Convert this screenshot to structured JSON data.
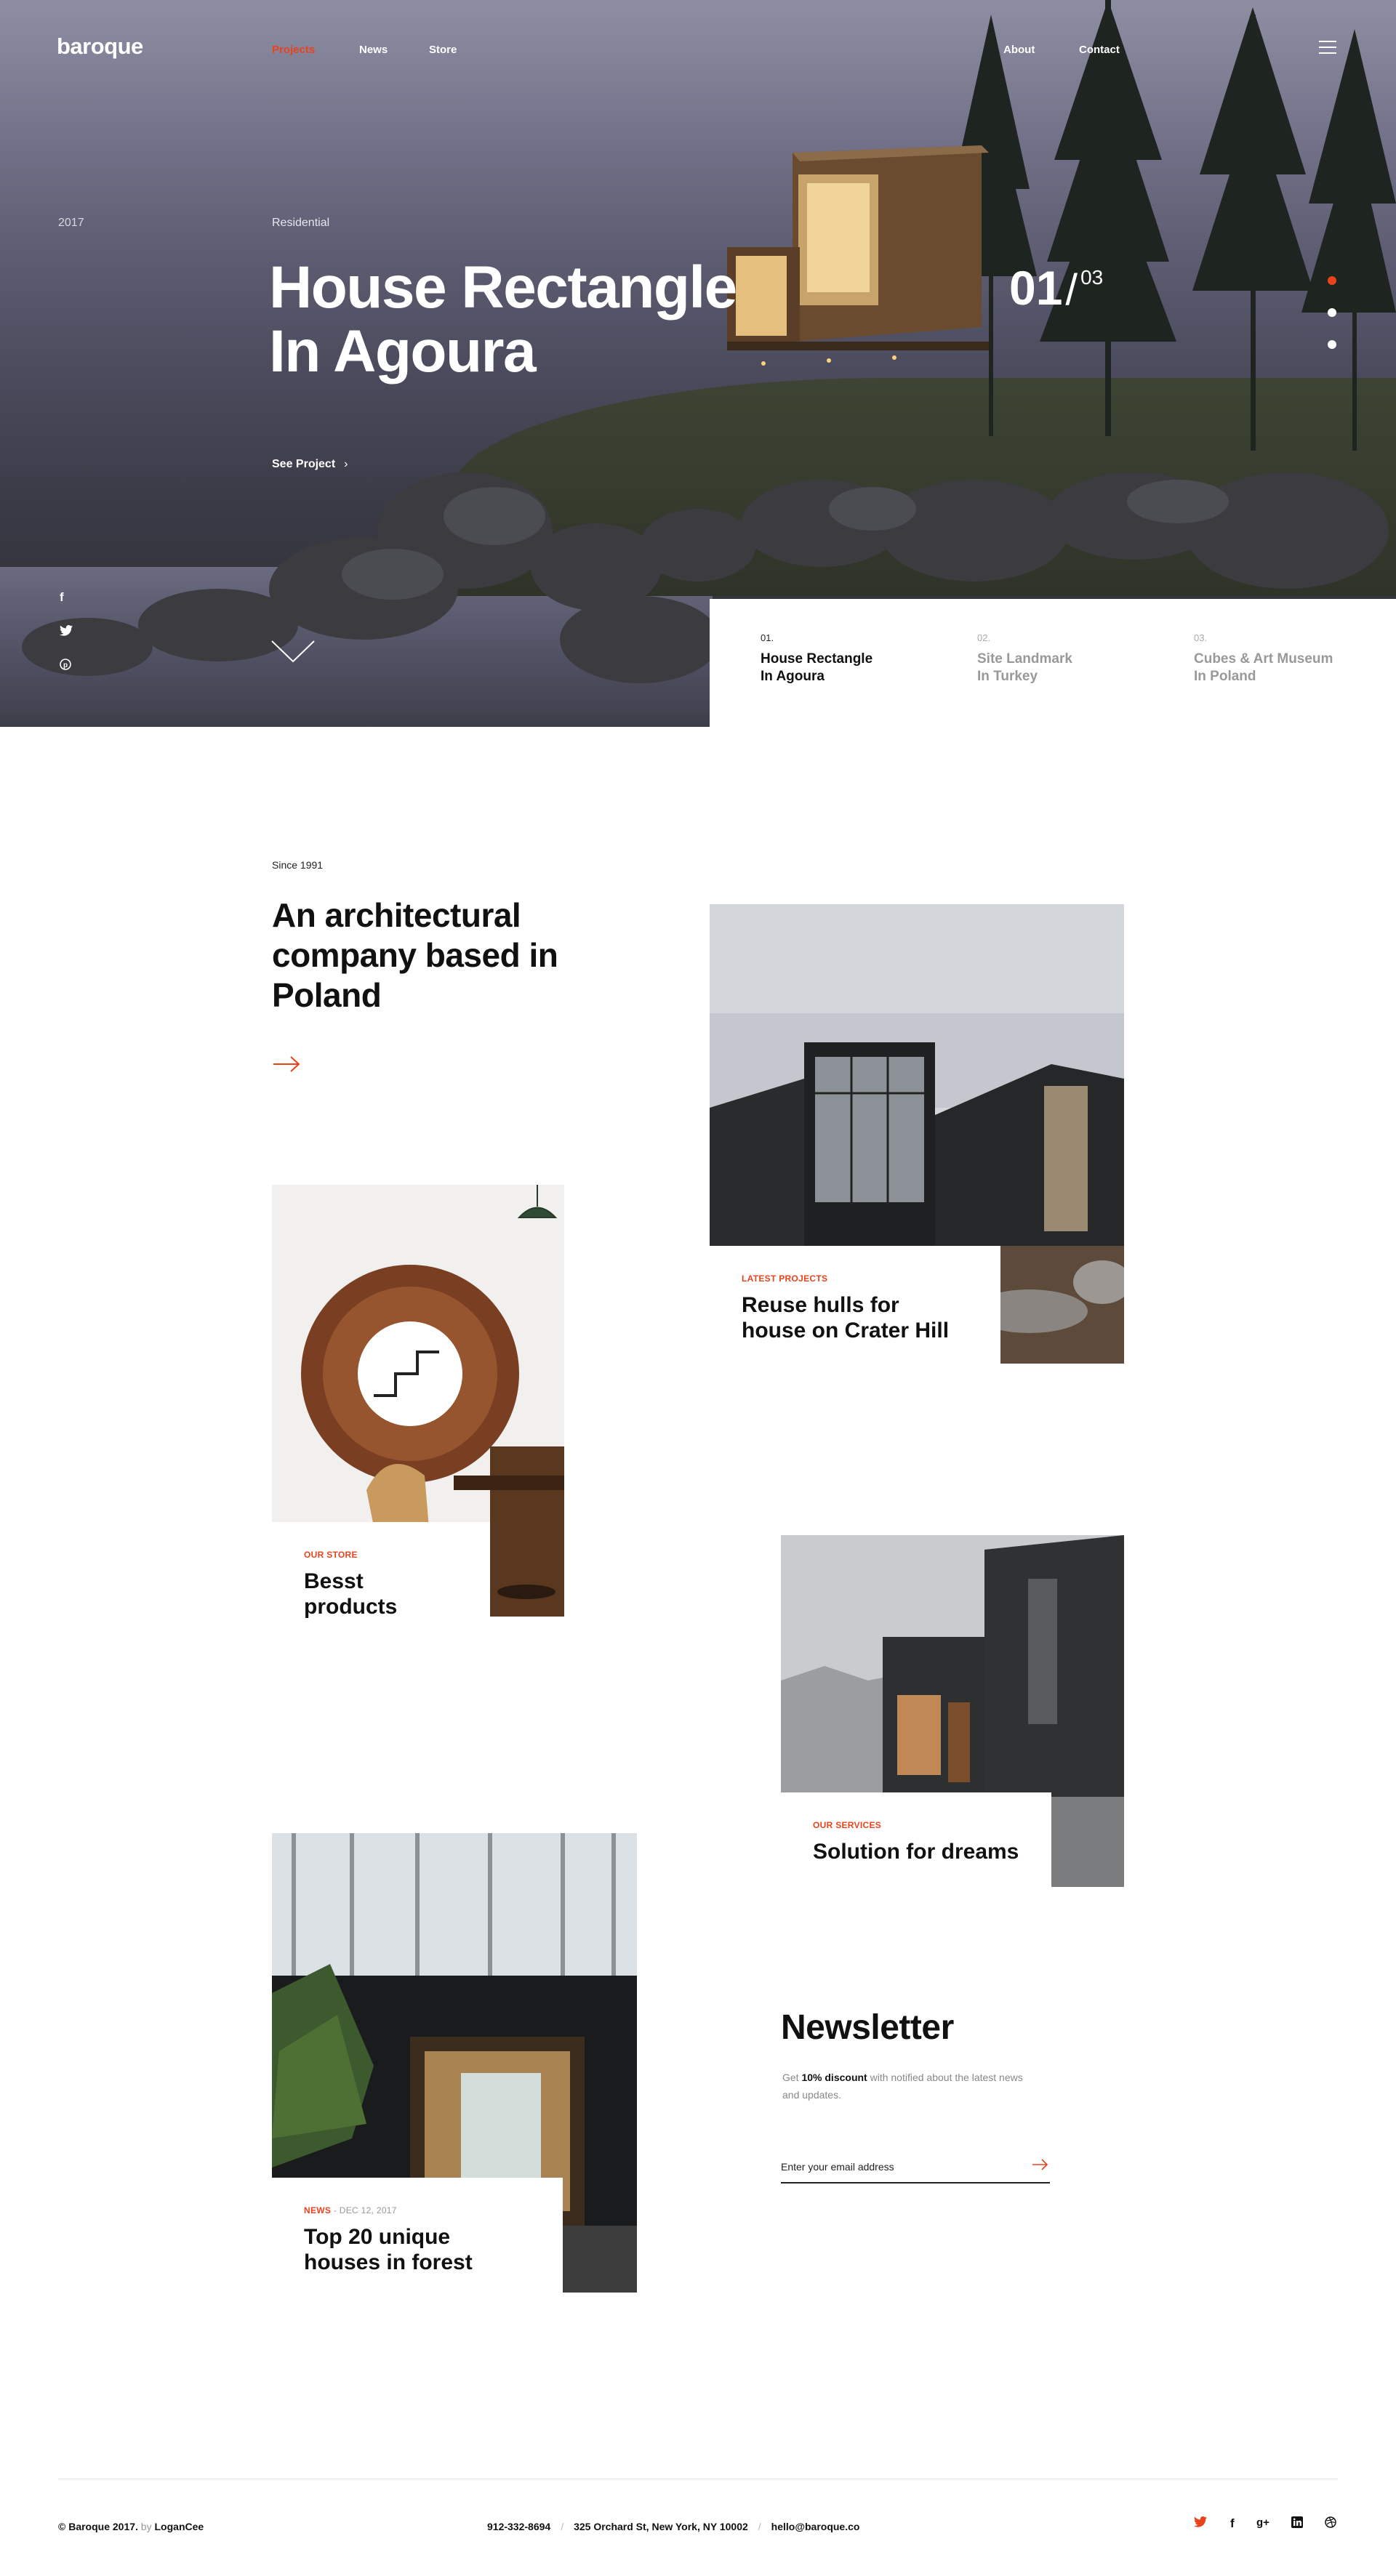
{
  "brand": {
    "logo": "baroque",
    "accent_color": "#e8431d"
  },
  "nav": {
    "left": [
      {
        "label": "Projects",
        "active": true
      },
      {
        "label": "News",
        "active": false
      },
      {
        "label": "Store",
        "active": false
      }
    ],
    "right": [
      {
        "label": "About"
      },
      {
        "label": "Contact"
      }
    ],
    "menu_icon": "hamburger-icon"
  },
  "hero": {
    "year": "2017",
    "category": "Residential",
    "title_line1": "House Rectangle",
    "title_line2": "In Agoura",
    "cta": "See Project",
    "counter_current": "01",
    "counter_separator": "/",
    "counter_total": "03",
    "active_dot": 1,
    "social_icons": [
      "facebook-icon",
      "twitter-icon",
      "pinterest-icon"
    ],
    "slides": [
      {
        "num": "01.",
        "line1": "House Rectangle",
        "line2": "In Agoura",
        "active": true
      },
      {
        "num": "02.",
        "line1": "Site Landmark",
        "line2": "In Turkey",
        "active": false
      },
      {
        "num": "03.",
        "line1": "Cubes & Art Museum",
        "line2": "In Poland",
        "active": false
      }
    ]
  },
  "about": {
    "since": "Since 1991",
    "title": "An architectural company based in Poland"
  },
  "cards": {
    "latest": {
      "category": "LATEST PROJECTS",
      "title": "Reuse hulls for house on Crater Hill"
    },
    "store": {
      "category": "OUR STORE",
      "title": "Besst products"
    },
    "services": {
      "category": "OUR SERVICES",
      "title": "Solution for dreams"
    },
    "news": {
      "category": "NEWS",
      "date": " - DEC 12, 2017",
      "title": "Top 20 unique houses in forest"
    }
  },
  "newsletter": {
    "title": "Newsletter",
    "text_before": "Get ",
    "text_bold": "10% discount",
    "text_after": " with notified about the latest news and updates.",
    "placeholder": "Enter your email address"
  },
  "footer": {
    "copyright": "© Baroque 2017.",
    "by_label": " by ",
    "author": "LoganCee",
    "phone": "912-332-8694",
    "address": "325 Orchard St, New York, NY 10002",
    "email": "hello@baroque.co",
    "separator": "/",
    "social_icons": [
      "twitter-icon",
      "facebook-icon",
      "google-plus-icon",
      "linkedin-icon",
      "dribbble-icon"
    ]
  }
}
